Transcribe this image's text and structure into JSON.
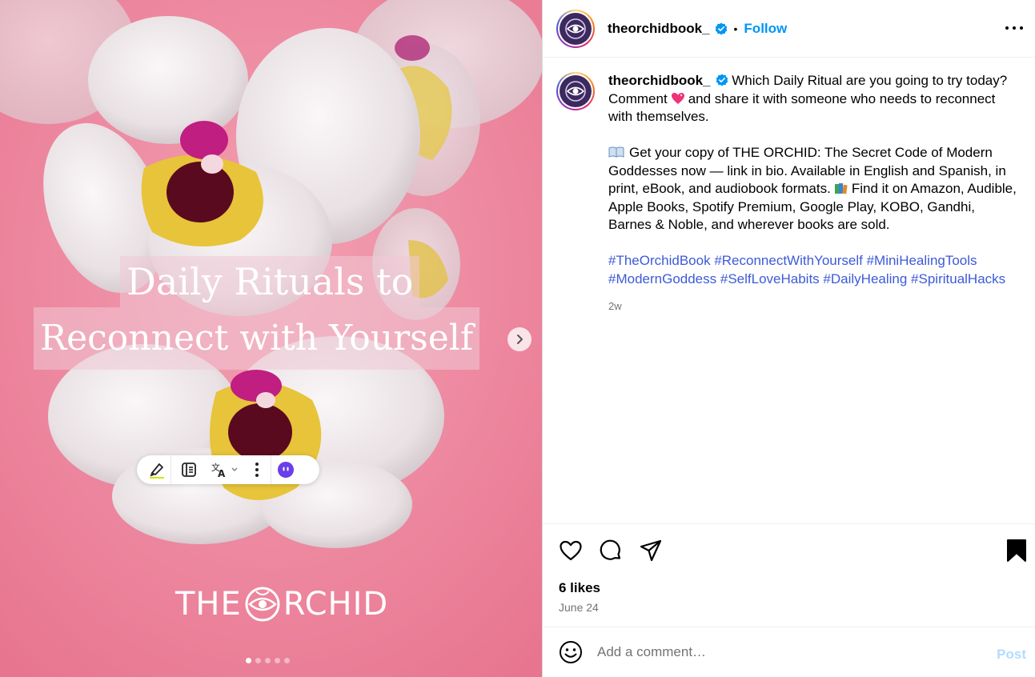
{
  "colors": {
    "background_pink": "#ec7f97",
    "link_blue": "#0095f6",
    "hashtag_blue": "#3d5ad8",
    "muted_gray": "#737373",
    "post_disabled": "#b3dbff"
  },
  "media": {
    "title_line_1": "Daily Rituals to",
    "title_line_2": "Reconnect with Yourself",
    "brand_left": "THE",
    "brand_right": "RCHID",
    "carousel_dots": 5,
    "active_dot": 0,
    "next_icon": "chevron-right-icon",
    "toolbar_icons": [
      "highlighter-icon",
      "reader-icon",
      "translate-icon",
      "more-vertical-icon",
      "assistant-icon"
    ]
  },
  "header": {
    "username": "theorchidbook_",
    "bullet": "•",
    "follow_label": "Follow",
    "verified_icon": "verified-badge-icon",
    "more_icon": "more-horizontal-icon"
  },
  "caption": {
    "username": "theorchidbook_",
    "line1_text": "Which Daily Ritual are you going to try today? Comment",
    "line1_after_emoji": "and share it with someone who needs to reconnect with themselves.",
    "para2_text": "Get your copy of THE ORCHID: The Secret Code of Modern Goddesses now — link in bio. Available in English and Spanish, in print, eBook, and audiobook formats.",
    "para2_after_emoji": "Find it on Amazon, Audible, Apple Books, Spotify Premium, Google Play, KOBO, Gandhi, Barnes & Noble, and wherever books are sold.",
    "hashtags": [
      "#TheOrchidBook",
      "#ReconnectWithYourself",
      "#MiniHealingTools",
      "#ModernGoddess",
      "#SelfLoveHabits",
      "#DailyHealing",
      "#SpiritualHacks"
    ],
    "time_ago": "2w"
  },
  "actions": {
    "icons": [
      "heart-icon",
      "comment-icon",
      "share-icon",
      "bookmark-icon"
    ],
    "likes": "6 likes",
    "date": "June 24"
  },
  "comment": {
    "placeholder": "Add a comment…",
    "post_label": "Post"
  }
}
